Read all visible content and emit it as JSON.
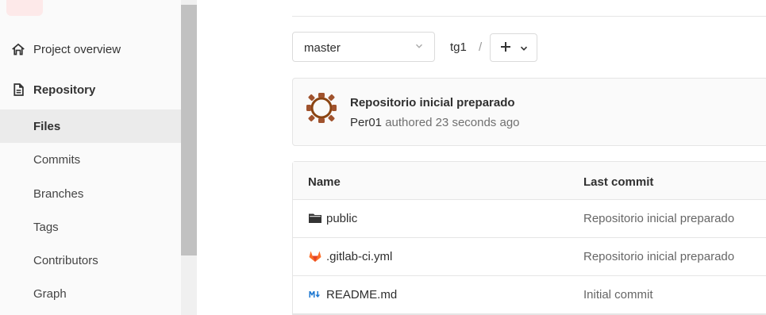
{
  "sidebar": {
    "items": [
      {
        "label": "Project overview",
        "icon": "home-icon"
      },
      {
        "label": "Repository",
        "icon": "document-icon"
      }
    ],
    "repository_sub": [
      {
        "label": "Files",
        "active": true
      },
      {
        "label": "Commits"
      },
      {
        "label": "Branches"
      },
      {
        "label": "Tags"
      },
      {
        "label": "Contributors"
      },
      {
        "label": "Graph"
      }
    ]
  },
  "toolbar": {
    "branch": "master",
    "path_segment": "tg1",
    "path_separator": "/",
    "add_button_icon": "plus-icon"
  },
  "last_commit": {
    "title": "Repositorio inicial preparado",
    "author": "Per01",
    "meta_suffix": "authored 23 seconds ago"
  },
  "file_table": {
    "headers": {
      "name": "Name",
      "last_commit": "Last commit"
    },
    "rows": [
      {
        "name": "public",
        "icon": "folder-icon",
        "last_commit": "Repositorio inicial preparado"
      },
      {
        "name": ".gitlab-ci.yml",
        "icon": "gitlab-icon",
        "last_commit": "Repositorio inicial preparado"
      },
      {
        "name": "README.md",
        "icon": "markdown-icon",
        "last_commit": "Initial commit"
      }
    ]
  },
  "colors": {
    "gitlab_orange": "#fc6d26",
    "markdown_blue": "#1f78d1",
    "avatar_brown": "#a0522d"
  }
}
